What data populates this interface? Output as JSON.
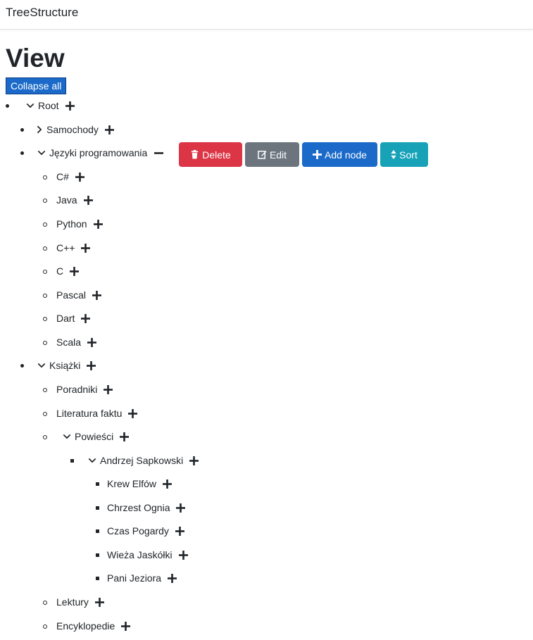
{
  "navbar": {
    "brand": "TreeStructure"
  },
  "page": {
    "title": "View",
    "collapse_label": "Collapse all"
  },
  "actions": {
    "delete": "Delete",
    "edit": "Edit",
    "add_node": "Add node",
    "sort": "Sort"
  },
  "tree": {
    "root": "Root",
    "samochody": "Samochody",
    "jezyki": "Języki programowania",
    "languages": [
      "C#",
      "Java",
      "Python",
      "C++",
      "C",
      "Pascal",
      "Dart",
      "Scala"
    ],
    "ksiazki": "Książki",
    "poradniki": "Poradniki",
    "literatura": "Literatura faktu",
    "powiesci": "Powieści",
    "sapkowski": "Andrzej Sapkowski",
    "sapkowski_books": [
      "Krew Elfów",
      "Chrzest Ognia",
      "Czas Pogardy",
      "Wieża Jaskółki",
      "Pani Jeziora"
    ],
    "lektury": "Lektury",
    "encyklopedie": "Encyklopedie"
  }
}
